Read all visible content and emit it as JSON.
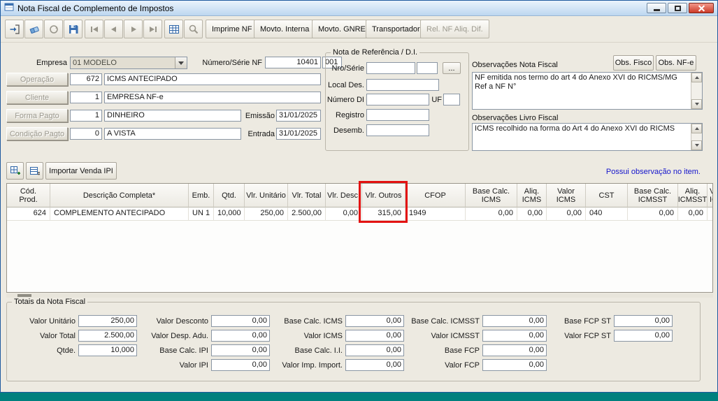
{
  "titlebar": {
    "title": "Nota Fiscal de Complemento de Impostos"
  },
  "toolbar": {
    "imprime_nf": "Imprime NF",
    "movto_interna": "Movto. Interna",
    "movto_gnre": "Movto. GNRE",
    "transportador": "Transportador",
    "rel_nf_aliq": "Rel. NF Aliq. Dif."
  },
  "icons": {
    "toolbar": [
      "exit-icon",
      "eraser-icon",
      "refresh-icon",
      "save-icon",
      "nav-first-icon",
      "nav-prev-icon",
      "nav-next-icon",
      "nav-last-icon",
      "grid-icon",
      "search-icon"
    ],
    "item_bar": [
      "grid-plus-icon",
      "grid-list-icon"
    ]
  },
  "header": {
    "empresa_label": "Empresa",
    "empresa_value": "01 MODELO",
    "numero_serie_label": "Número/Série NF",
    "numero_nf": "10401",
    "serie_nf": "001",
    "operacao_label": "Operação",
    "operacao_cod": "672",
    "operacao_desc": "ICMS ANTECIPADO",
    "cliente_label": "Cliente",
    "cliente_cod": "1",
    "cliente_desc": "EMPRESA NF-e",
    "forma_pagto_label": "Forma Pagto",
    "forma_pagto_cod": "1",
    "forma_pagto_desc": "DINHEIRO",
    "emissao_label": "Emissão",
    "emissao_value": "31/01/2025",
    "condicao_pagto_label": "Condição Pagto",
    "condicao_pagto_cod": "0",
    "condicao_pagto_desc": "A VISTA",
    "entrada_label": "Entrada",
    "entrada_value": "31/01/2025"
  },
  "referencia": {
    "group_title": "Nota de Referência / D.I.",
    "nro_serie_label": "Nro/Série",
    "nro_serie_value1": "",
    "nro_serie_value2": "",
    "browse_button": "...",
    "local_des_label": "Local Des.",
    "local_des_value": "",
    "numero_di_label": "Número DI",
    "numero_di_value": "",
    "uf_label": "UF",
    "uf_value": "",
    "registro_label": "Registro",
    "registro_value": "",
    "desemb_label": "Desemb.",
    "desemb_value": ""
  },
  "observacoes": {
    "nf_label": "Observações Nota Fiscal",
    "obs_fisco_button": "Obs. Fisco",
    "obs_nfe_button": "Obs. NF-e",
    "nf_text": "NF emitida nos termo do art 4 do Anexo XVI do RICMS/MG Ref a NF N°",
    "livro_label": "Observações Livro Fiscal",
    "livro_text": "ICMS recolhido na forma do Art 4 do Anexo XVI do RICMS"
  },
  "item_bar": {
    "importar_venda_ipi": "Importar Venda IPI",
    "possui_observacao": "Possui observação no item."
  },
  "grid": {
    "columns": [
      "Cód.\nProd.",
      "Descrição Completa*",
      "Emb.",
      "Qtd.",
      "Vlr. Unitário",
      "Vlr. Total",
      "Vlr. Desc.",
      "Vlr. Outros",
      "CFOP",
      "Base Calc.\nICMS",
      "Aliq.\nICMS",
      "Valor ICMS",
      "CST",
      "Base Calc.\nICMSST",
      "Aliq.\nICMSST",
      "V\nIC"
    ],
    "row": {
      "cod_prod": "624",
      "descricao": "COMPLEMENTO ANTECIPADO",
      "emb": "UN 1",
      "qtd": "10,000",
      "vlr_unitario": "250,00",
      "vlr_total": "2.500,00",
      "vlr_desc": "0,00",
      "vlr_outros": "315,00",
      "cfop": "1949",
      "base_calc_icms": "0,00",
      "aliq_icms": "0,00",
      "valor_icms": "0,00",
      "cst": "040",
      "base_calc_icmsst": "0,00",
      "aliq_icmsst": "0,00",
      "v_ic": ""
    }
  },
  "totais": {
    "group_title": "Totais da Nota Fiscal",
    "c1": [
      {
        "label": "Valor Unitário",
        "value": "250,00"
      },
      {
        "label": "Valor Total",
        "value": "2.500,00"
      },
      {
        "label": "Qtde.",
        "value": "10,000"
      }
    ],
    "c2": [
      {
        "label": "Valor Desconto",
        "value": "0,00"
      },
      {
        "label": "Valor Desp. Adu.",
        "value": "0,00"
      },
      {
        "label": "Base Calc. IPI",
        "value": "0,00"
      },
      {
        "label": "Valor IPI",
        "value": "0,00"
      }
    ],
    "c3": [
      {
        "label": "Base Calc. ICMS",
        "value": "0,00"
      },
      {
        "label": "Valor ICMS",
        "value": "0,00"
      },
      {
        "label": "Base Calc. I.I.",
        "value": "0,00"
      },
      {
        "label": "Valor Imp. Import.",
        "value": "0,00"
      }
    ],
    "c4": [
      {
        "label": "Base Calc. ICMSST",
        "value": "0,00"
      },
      {
        "label": "Valor ICMSST",
        "value": "0,00"
      },
      {
        "label": "Base FCP",
        "value": "0,00"
      },
      {
        "label": "Valor FCP",
        "value": "0,00"
      }
    ],
    "c5": [
      {
        "label": "Base FCP ST",
        "value": "0,00"
      },
      {
        "label": "Valor FCP ST",
        "value": "0,00"
      }
    ]
  }
}
